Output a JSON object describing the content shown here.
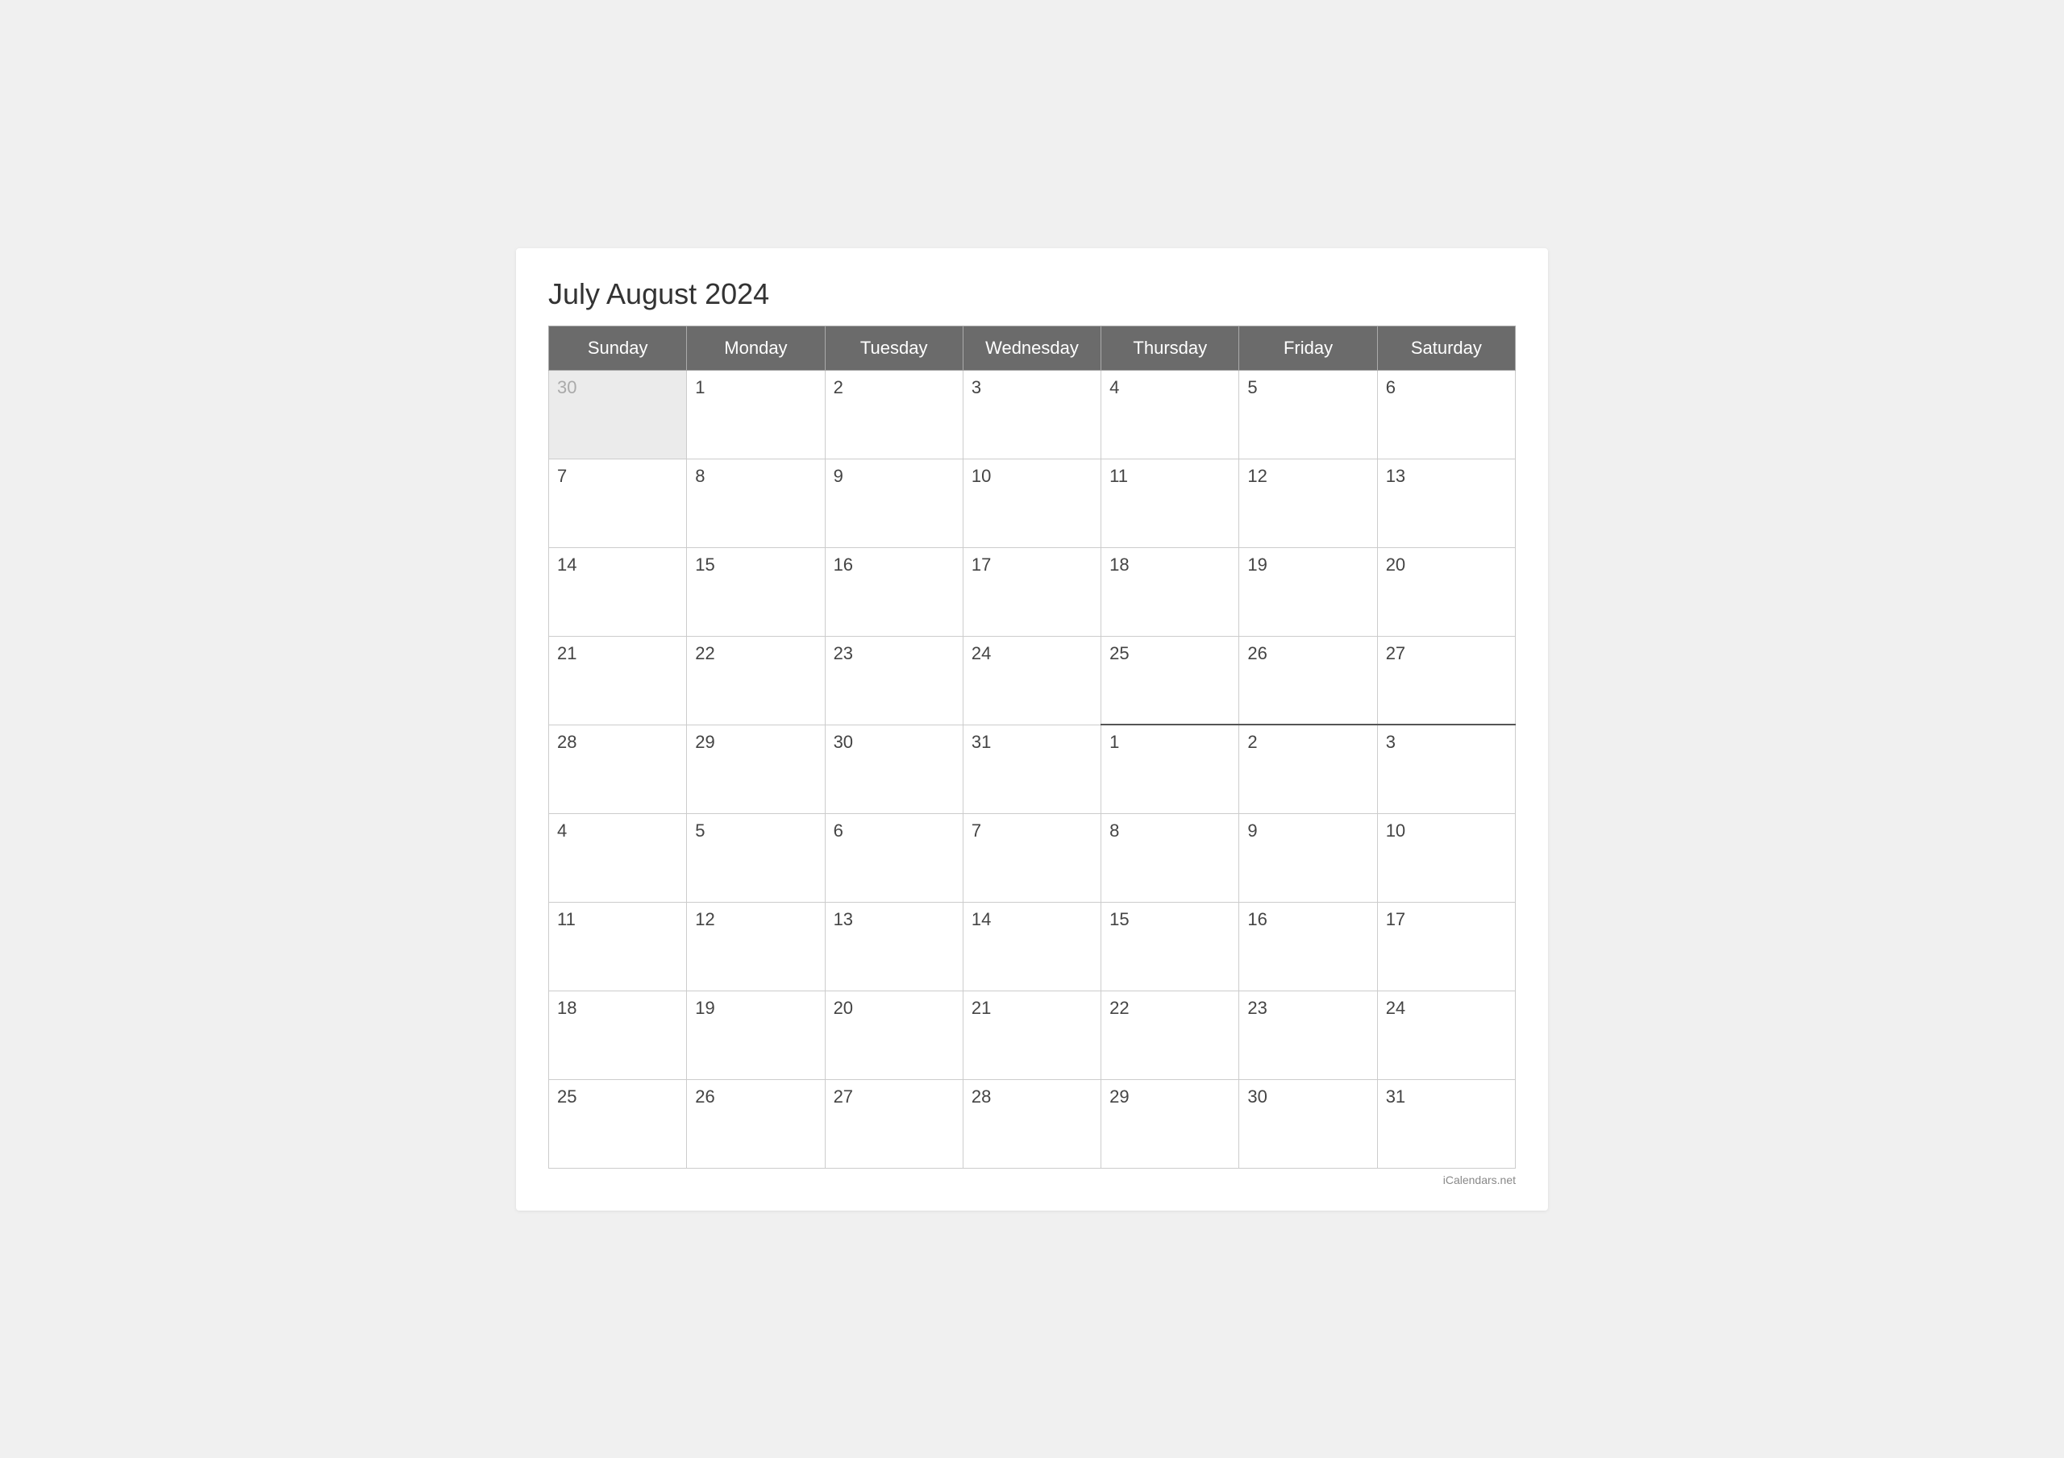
{
  "title": "July August 2024",
  "watermark": "iCalendars.net",
  "headers": [
    "Sunday",
    "Monday",
    "Tuesday",
    "Wednesday",
    "Thursday",
    "Friday",
    "Saturday"
  ],
  "weeks": [
    [
      {
        "day": "30",
        "type": "prev-month"
      },
      {
        "day": "1",
        "type": "july"
      },
      {
        "day": "2",
        "type": "july"
      },
      {
        "day": "3",
        "type": "july"
      },
      {
        "day": "4",
        "type": "july"
      },
      {
        "day": "5",
        "type": "july"
      },
      {
        "day": "6",
        "type": "july"
      }
    ],
    [
      {
        "day": "7",
        "type": "july"
      },
      {
        "day": "8",
        "type": "july"
      },
      {
        "day": "9",
        "type": "july"
      },
      {
        "day": "10",
        "type": "july"
      },
      {
        "day": "11",
        "type": "july"
      },
      {
        "day": "12",
        "type": "july"
      },
      {
        "day": "13",
        "type": "july"
      }
    ],
    [
      {
        "day": "14",
        "type": "july"
      },
      {
        "day": "15",
        "type": "july"
      },
      {
        "day": "16",
        "type": "july"
      },
      {
        "day": "17",
        "type": "july"
      },
      {
        "day": "18",
        "type": "july"
      },
      {
        "day": "19",
        "type": "july"
      },
      {
        "day": "20",
        "type": "july"
      }
    ],
    [
      {
        "day": "21",
        "type": "july"
      },
      {
        "day": "22",
        "type": "july"
      },
      {
        "day": "23",
        "type": "july"
      },
      {
        "day": "24",
        "type": "july"
      },
      {
        "day": "25",
        "type": "july"
      },
      {
        "day": "26",
        "type": "july"
      },
      {
        "day": "27",
        "type": "july"
      }
    ],
    [
      {
        "day": "28",
        "type": "july"
      },
      {
        "day": "29",
        "type": "july"
      },
      {
        "day": "30",
        "type": "july"
      },
      {
        "day": "31",
        "type": "july"
      },
      {
        "day": "1",
        "type": "aug-start"
      },
      {
        "day": "2",
        "type": "aug-start"
      },
      {
        "day": "3",
        "type": "aug-start"
      }
    ],
    [
      {
        "day": "4",
        "type": "august"
      },
      {
        "day": "5",
        "type": "august"
      },
      {
        "day": "6",
        "type": "august"
      },
      {
        "day": "7",
        "type": "august"
      },
      {
        "day": "8",
        "type": "august"
      },
      {
        "day": "9",
        "type": "august"
      },
      {
        "day": "10",
        "type": "august"
      }
    ],
    [
      {
        "day": "11",
        "type": "august"
      },
      {
        "day": "12",
        "type": "august"
      },
      {
        "day": "13",
        "type": "august"
      },
      {
        "day": "14",
        "type": "august"
      },
      {
        "day": "15",
        "type": "august"
      },
      {
        "day": "16",
        "type": "august"
      },
      {
        "day": "17",
        "type": "august"
      }
    ],
    [
      {
        "day": "18",
        "type": "august"
      },
      {
        "day": "19",
        "type": "august"
      },
      {
        "day": "20",
        "type": "august"
      },
      {
        "day": "21",
        "type": "august"
      },
      {
        "day": "22",
        "type": "august"
      },
      {
        "day": "23",
        "type": "august"
      },
      {
        "day": "24",
        "type": "august"
      }
    ],
    [
      {
        "day": "25",
        "type": "august"
      },
      {
        "day": "26",
        "type": "august"
      },
      {
        "day": "27",
        "type": "august"
      },
      {
        "day": "28",
        "type": "august"
      },
      {
        "day": "29",
        "type": "august"
      },
      {
        "day": "30",
        "type": "august"
      },
      {
        "day": "31",
        "type": "august"
      }
    ]
  ]
}
